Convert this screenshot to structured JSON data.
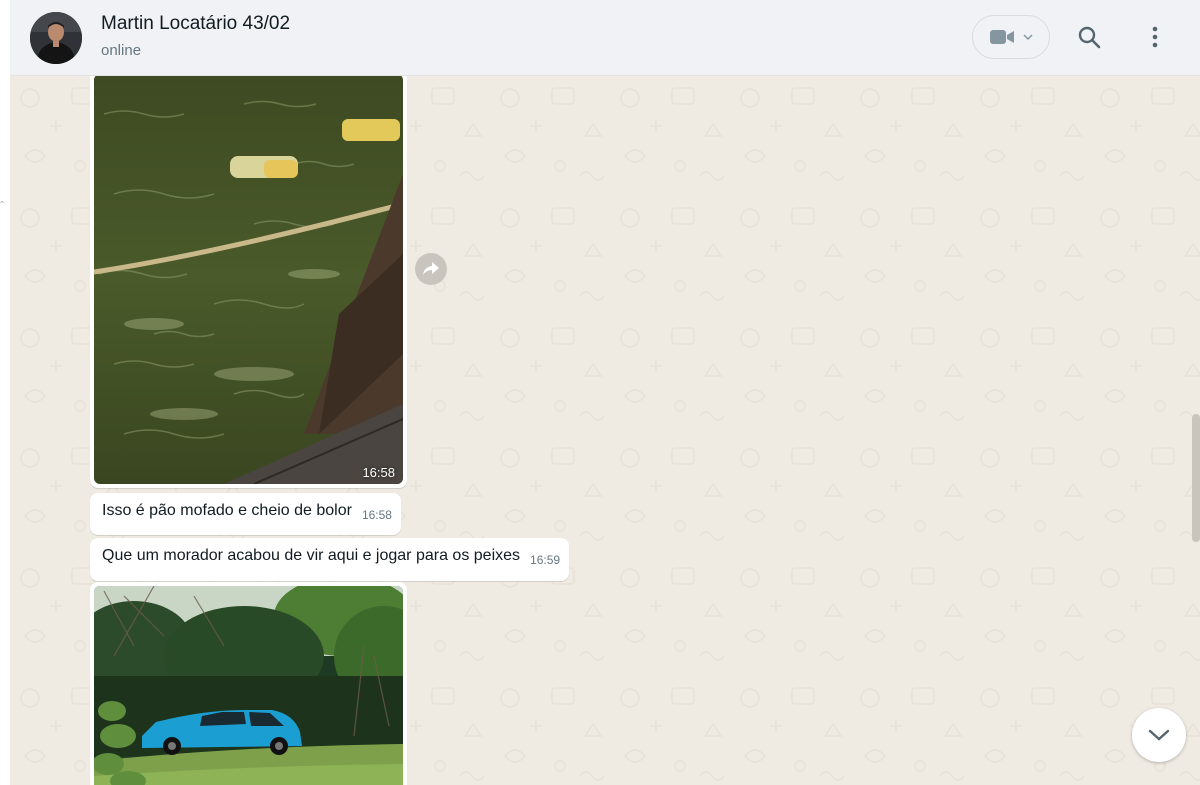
{
  "header": {
    "contact_name": "Martin Locatário 43/02",
    "status": "online",
    "icons": {
      "video_call": "video-camera-icon",
      "video_dropdown": "chevron-down-icon",
      "search": "search-icon",
      "menu": "kebab-menu-icon"
    }
  },
  "messages": [
    {
      "type": "image",
      "image_subject": "river-water-with-bread",
      "time": "16:58"
    },
    {
      "type": "text",
      "text": "Isso é pão mofado e cheio de bolor",
      "time": "16:58"
    },
    {
      "type": "text",
      "text": "Que um morador acabou de vir aqui e jogar para os peixes",
      "time": "16:59"
    },
    {
      "type": "image",
      "image_subject": "blue-car-in-park",
      "time": ""
    }
  ],
  "icons": {
    "forward": "forward-icon",
    "scroll_down": "chevron-down-icon"
  },
  "colors": {
    "header_bg": "#f0f2f5",
    "chat_bg": "#efeae2",
    "bubble_bg": "#ffffff",
    "text_primary": "#111b21",
    "text_secondary": "#667781"
  }
}
